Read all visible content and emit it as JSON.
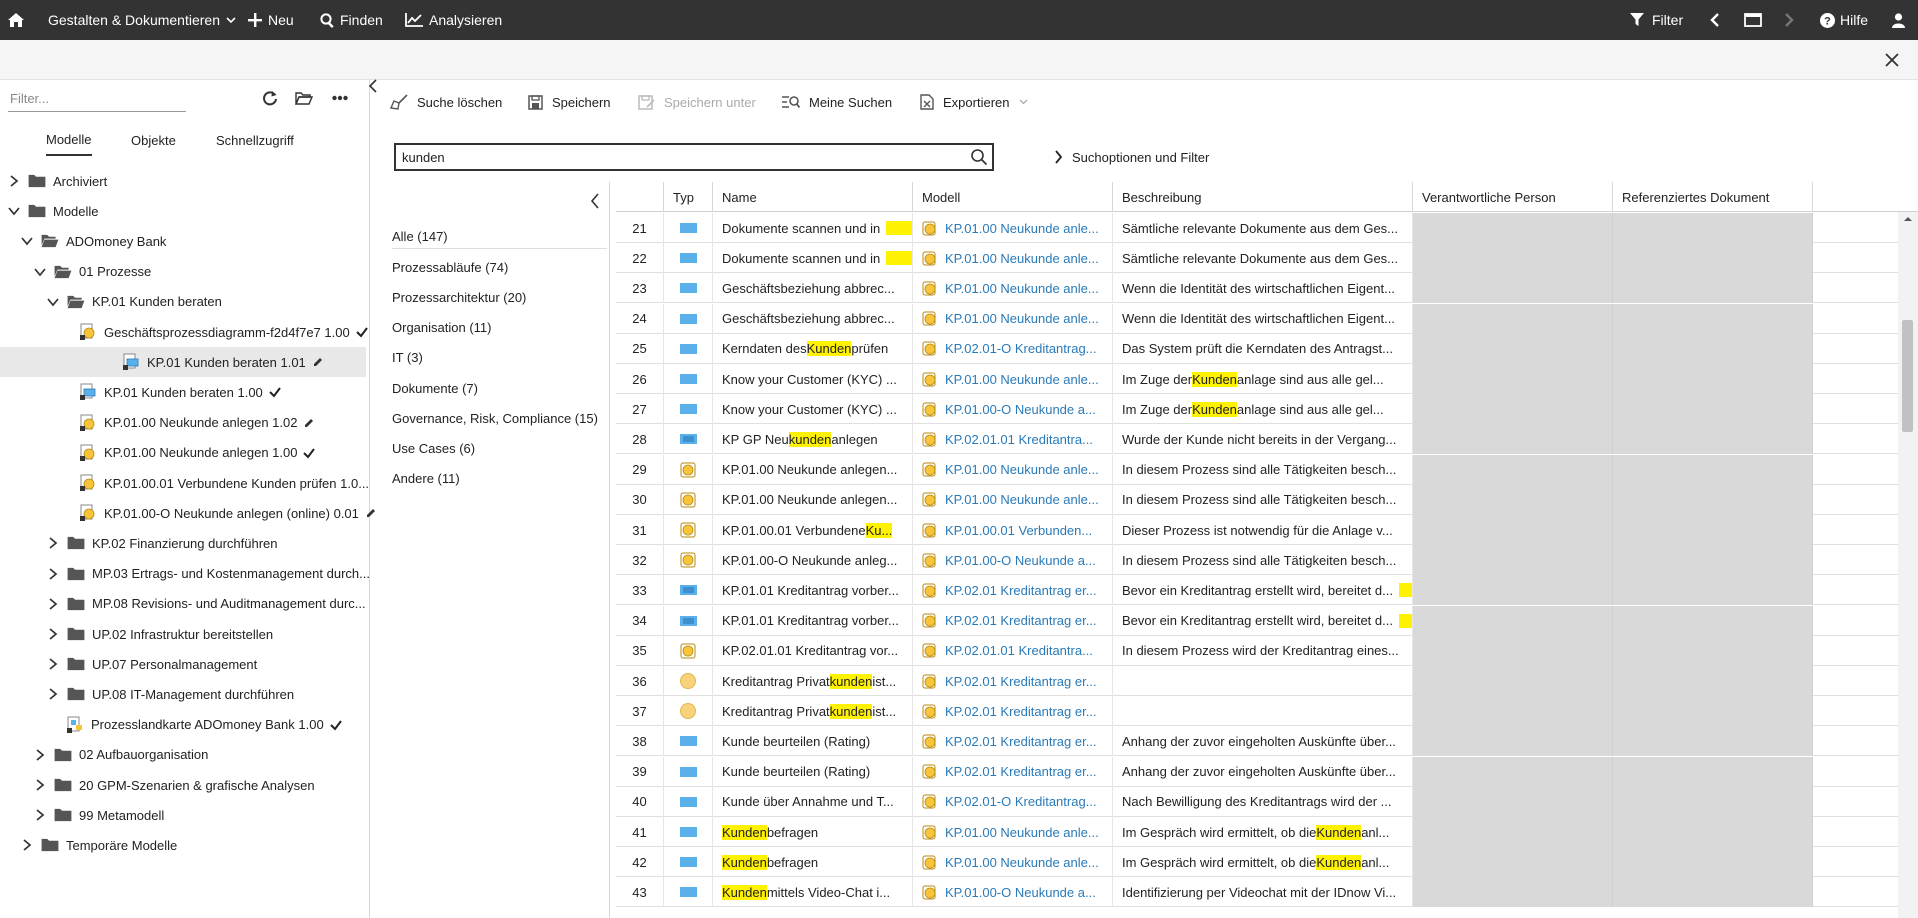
{
  "topbar": {
    "home_icon": "home-icon",
    "menu_design": "Gestalten & Dokumentieren",
    "menu_new": "Neu",
    "menu_find": "Finden",
    "menu_analyze": "Analysieren",
    "filter": "Filter",
    "help": "Hilfe"
  },
  "left": {
    "filter_placeholder": "Filter...",
    "tabs": [
      "Modelle",
      "Objekte",
      "Schnellzugriff"
    ],
    "tree": [
      {
        "label": "Archiviert",
        "level": 0,
        "kind": "folder",
        "expand": "collapsed"
      },
      {
        "label": "Modelle",
        "level": 0,
        "kind": "folder",
        "expand": "expanded"
      },
      {
        "label": "ADOmoney Bank",
        "level": 1,
        "kind": "folder-open",
        "expand": "expanded"
      },
      {
        "label": "01 Prozesse",
        "level": 2,
        "kind": "folder-open",
        "expand": "expanded"
      },
      {
        "label": "KP.01 Kunden beraten",
        "level": 3,
        "kind": "folder-open",
        "expand": "expanded"
      },
      {
        "label": "Geschäftsprozessdiagramm-f2d4f7e7 1.00",
        "level": 4,
        "kind": "model-yellow",
        "status": "check"
      },
      {
        "label": "KP.01 Kunden beraten 1.01",
        "level": 4,
        "kind": "model-blue",
        "status": "pencil",
        "selected": true
      },
      {
        "label": "KP.01 Kunden beraten 1.00",
        "level": 4,
        "kind": "model-blue",
        "status": "check"
      },
      {
        "label": "KP.01.00 Neukunde anlegen 1.02",
        "level": 4,
        "kind": "model-yellow",
        "status": "pencil"
      },
      {
        "label": "KP.01.00 Neukunde anlegen 1.00",
        "level": 4,
        "kind": "model-yellow",
        "status": "check"
      },
      {
        "label": "KP.01.00.01 Verbundene Kunden prüfen 1.0...",
        "level": 4,
        "kind": "model-yellow",
        "status": ""
      },
      {
        "label": "KP.01.00-O Neukunde anlegen (online) 0.01",
        "level": 4,
        "kind": "model-yellow",
        "status": "pencil"
      },
      {
        "label": "KP.02 Finanzierung durchführen",
        "level": 3,
        "kind": "folder",
        "expand": "collapsed"
      },
      {
        "label": "MP.03 Ertrags- und Kostenmanagement durch...",
        "level": 3,
        "kind": "folder",
        "expand": "collapsed"
      },
      {
        "label": "MP.08 Revisions- und Auditmanagement durc...",
        "level": 3,
        "kind": "folder",
        "expand": "collapsed"
      },
      {
        "label": "UP.02 Infrastruktur bereitstellen",
        "level": 3,
        "kind": "folder",
        "expand": "collapsed"
      },
      {
        "label": "UP.07 Personalmanagement",
        "level": 3,
        "kind": "folder",
        "expand": "collapsed"
      },
      {
        "label": "UP.08 IT-Management durchführen",
        "level": 3,
        "kind": "folder",
        "expand": "collapsed"
      },
      {
        "label": "Prozesslandkarte ADOmoney Bank 1.00",
        "level": 3,
        "kind": "model-map",
        "status": "check"
      },
      {
        "label": "02 Aufbauorganisation",
        "level": 2,
        "kind": "folder",
        "expand": "collapsed"
      },
      {
        "label": "20 GPM-Szenarien & grafische Analysen",
        "level": 2,
        "kind": "folder",
        "expand": "collapsed"
      },
      {
        "label": "99 Metamodell",
        "level": 2,
        "kind": "folder",
        "expand": "collapsed"
      },
      {
        "label": "Temporäre Modelle",
        "level": 1,
        "kind": "folder",
        "expand": "collapsed"
      }
    ]
  },
  "toolbar": {
    "clear_search": "Suche löschen",
    "save": "Speichern",
    "save_as": "Speichern unter",
    "my_searches": "Meine Suchen",
    "export": "Exportieren"
  },
  "search": {
    "value": "kunden",
    "options": "Suchoptionen und Filter"
  },
  "categories": [
    "Alle (147)",
    "Prozessabläufe (74)",
    "Prozessarchitektur (20)",
    "Organisation (11)",
    "IT (3)",
    "Dokumente (7)",
    "Governance, Risk, Compliance (15)",
    "Use Cases (6)",
    "Andere (11)"
  ],
  "grid": {
    "columns": [
      "",
      "Typ",
      "Name",
      "Modell",
      "Beschreibung",
      "Verantwortliche Person",
      "Referenziertes Dokument"
    ],
    "rows": [
      {
        "n": "21",
        "typ": "rect",
        "name": [
          "Dokumente scannen und in ",
          ""
        ],
        "namehl": "block",
        "model": "KP.01.00 Neukunde anle...",
        "desc": [
          "Sämtliche relevante Dokumente aus dem Ges..."
        ]
      },
      {
        "n": "22",
        "typ": "rect",
        "name": [
          "Dokumente scannen und in ",
          ""
        ],
        "namehl": "block",
        "model": "KP.01.00 Neukunde anle...",
        "desc": [
          "Sämtliche relevante Dokumente aus dem Ges..."
        ]
      },
      {
        "n": "23",
        "typ": "rect",
        "name": [
          "Geschäftsbeziehung abbrec..."
        ],
        "model": "KP.01.00 Neukunde anle...",
        "desc": [
          "Wenn die Identität des wirtschaftlichen Eigent..."
        ]
      },
      {
        "n": "24",
        "typ": "rect",
        "name": [
          "Geschäftsbeziehung abbrec..."
        ],
        "model": "KP.01.00 Neukunde anle...",
        "desc": [
          "Wenn die Identität des wirtschaftlichen Eigent..."
        ]
      },
      {
        "n": "25",
        "typ": "rect",
        "name": [
          "Kerndaten des ",
          "Kunden",
          " prüfen"
        ],
        "model": "KP.02.01-O Kreditantrag...",
        "desc": [
          "Das System prüft die Kerndaten des Antragst..."
        ]
      },
      {
        "n": "26",
        "typ": "rect",
        "name": [
          "Know your Customer (KYC) ..."
        ],
        "model": "KP.01.00 Neukunde anle...",
        "desc": [
          "Im Zuge der ",
          "Kunden",
          "anlage sind aus alle gel..."
        ]
      },
      {
        "n": "27",
        "typ": "rect",
        "name": [
          "Know your Customer (KYC) ..."
        ],
        "model": "KP.01.00-O Neukunde a...",
        "desc": [
          "Im Zuge der ",
          "Kunden",
          "anlage sind aus alle gel..."
        ]
      },
      {
        "n": "28",
        "typ": "map",
        "name": [
          "KP GP Neu",
          "kunden",
          " anlegen"
        ],
        "model": "KP.02.01.01 Kreditantra...",
        "desc": [
          "Wurde der Kunde nicht bereits in der Vergang..."
        ]
      },
      {
        "n": "29",
        "typ": "proc",
        "name": [
          "KP.01.00 Neukunde anlegen..."
        ],
        "model": "KP.01.00 Neukunde anle...",
        "desc": [
          "In diesem Prozess sind alle Tätigkeiten besch..."
        ]
      },
      {
        "n": "30",
        "typ": "proc",
        "name": [
          "KP.01.00 Neukunde anlegen..."
        ],
        "model": "KP.01.00 Neukunde anle...",
        "desc": [
          "In diesem Prozess sind alle Tätigkeiten besch..."
        ]
      },
      {
        "n": "31",
        "typ": "proc",
        "name": [
          "KP.01.00.01 Verbundene ",
          "Ku..."
        ],
        "model": "KP.01.00.01 Verbunden...",
        "desc": [
          "Dieser Prozess ist notwendig für die Anlage v..."
        ]
      },
      {
        "n": "32",
        "typ": "proc",
        "name": [
          "KP.01.00-O Neukunde anleg..."
        ],
        "model": "KP.01.00-O Neukunde a...",
        "desc": [
          "In diesem Prozess sind alle Tätigkeiten besch..."
        ]
      },
      {
        "n": "33",
        "typ": "map",
        "name": [
          "KP.01.01 Kreditantrag vorber..."
        ],
        "model": "KP.02.01 Kreditantrag er...",
        "desc": [
          "Bevor ein Kreditantrag erstellt wird, bereitet d...",
          ""
        ],
        "deschl": "block"
      },
      {
        "n": "34",
        "typ": "map",
        "name": [
          "KP.01.01 Kreditantrag vorber..."
        ],
        "model": "KP.02.01 Kreditantrag er...",
        "desc": [
          "Bevor ein Kreditantrag erstellt wird, bereitet d...",
          ""
        ],
        "deschl": "block"
      },
      {
        "n": "35",
        "typ": "proc",
        "name": [
          "KP.02.01.01 Kreditantrag vor..."
        ],
        "model": "KP.02.01.01 Kreditantra...",
        "desc": [
          "In diesem Prozess wird der Kreditantrag eines..."
        ]
      },
      {
        "n": "36",
        "typ": "circle",
        "name": [
          "Kreditantrag Privat",
          "kunden",
          " ist..."
        ],
        "model": "KP.02.01 Kreditantrag er...",
        "desc": [
          ""
        ]
      },
      {
        "n": "37",
        "typ": "circle",
        "name": [
          "Kreditantrag Privat",
          "kunden",
          " ist..."
        ],
        "model": "KP.02.01 Kreditantrag er...",
        "desc": [
          ""
        ]
      },
      {
        "n": "38",
        "typ": "rect",
        "name": [
          "Kunde beurteilen (Rating)"
        ],
        "model": "KP.02.01 Kreditantrag er...",
        "desc": [
          "Anhang der zuvor eingeholten Auskünfte über..."
        ]
      },
      {
        "n": "39",
        "typ": "rect",
        "name": [
          "Kunde beurteilen (Rating)"
        ],
        "model": "KP.02.01 Kreditantrag er...",
        "desc": [
          "Anhang der zuvor eingeholten Auskünfte über..."
        ]
      },
      {
        "n": "40",
        "typ": "rect",
        "name": [
          "Kunde über Annahme und T..."
        ],
        "model": "KP.02.01-O Kreditantrag...",
        "desc": [
          "Nach Bewilligung des Kreditantrags wird der ..."
        ]
      },
      {
        "n": "41",
        "typ": "rect",
        "name": [
          "",
          "Kunden",
          " befragen"
        ],
        "model": "KP.01.00 Neukunde anle...",
        "desc": [
          "Im Gespräch wird ermittelt, ob die ",
          "Kunden",
          "anl..."
        ]
      },
      {
        "n": "42",
        "typ": "rect",
        "name": [
          "",
          "Kunden",
          " befragen"
        ],
        "model": "KP.01.00 Neukunde anle...",
        "desc": [
          "Im Gespräch wird ermittelt, ob die ",
          "Kunden",
          "anl..."
        ]
      },
      {
        "n": "43",
        "typ": "rect",
        "name": [
          "",
          "Kunden",
          " mittels Video-Chat i..."
        ],
        "model": "KP.01.00-O Neukunde a...",
        "desc": [
          "Identifizierung per Videochat mit der IDnow Vi..."
        ]
      }
    ]
  }
}
